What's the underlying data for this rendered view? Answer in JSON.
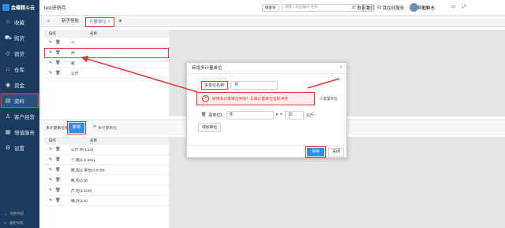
{
  "sidebar": {
    "brand": "金蝶精斗云",
    "items": [
      {
        "label": "收藏",
        "icon": "star-icon"
      },
      {
        "label": "购货",
        "icon": "cart-icon"
      },
      {
        "label": "销货",
        "icon": "tag-icon"
      },
      {
        "label": "仓库",
        "icon": "warehouse-icon"
      },
      {
        "label": "资金",
        "icon": "money-icon"
      },
      {
        "label": "资料",
        "icon": "document-icon"
      },
      {
        "label": "客户经营",
        "icon": "user-icon"
      },
      {
        "label": "增值服务",
        "icon": "grid-icon"
      },
      {
        "label": "设置",
        "icon": "gear-icon"
      }
    ],
    "bottom": [
      "浅色导航",
      "收起导航"
    ]
  },
  "topbar": {
    "app_name": "test进销存",
    "search_label": "搜索导",
    "search_placeholder": "请输入商品编码/名称",
    "links": [
      "联系我们",
      "我在线服务",
      "帮助中心"
    ],
    "user": "七彩"
  },
  "tabs": [
    {
      "label": "新手导航"
    },
    {
      "label": "计量单位 ×"
    }
  ],
  "upper_grid": {
    "col_ops": "操作",
    "col_name": "名称",
    "rows": [
      "个",
      "件",
      "瓶",
      "公斤"
    ]
  },
  "lower": {
    "label": "多计量单位组",
    "add_button": "新增",
    "link": "多计量单位",
    "col_ops": "操作",
    "col_name": "名称",
    "rows": [
      "公斤,件(1:10)",
      "个,瓶(1:0.001)",
      "瓶,包(1,单位(1:0.33)",
      "瓶,包(1:5)",
      "斤,包(1:100)",
      "桶,升(1:5)"
    ]
  },
  "dialog": {
    "title": "新增多计量单位",
    "name_label": "多单位名称:",
    "name_value": "件",
    "error": "新增多计量单位失败！与单计量单位名称冲突",
    "error_tail": "小度量单位",
    "sub_unit_label": "副单位1:",
    "sub_unit_value": "件",
    "equals": "=",
    "qty": "10",
    "unit": "公斤",
    "add_unit": "增加单位",
    "save": "保存",
    "close": "关闭"
  }
}
